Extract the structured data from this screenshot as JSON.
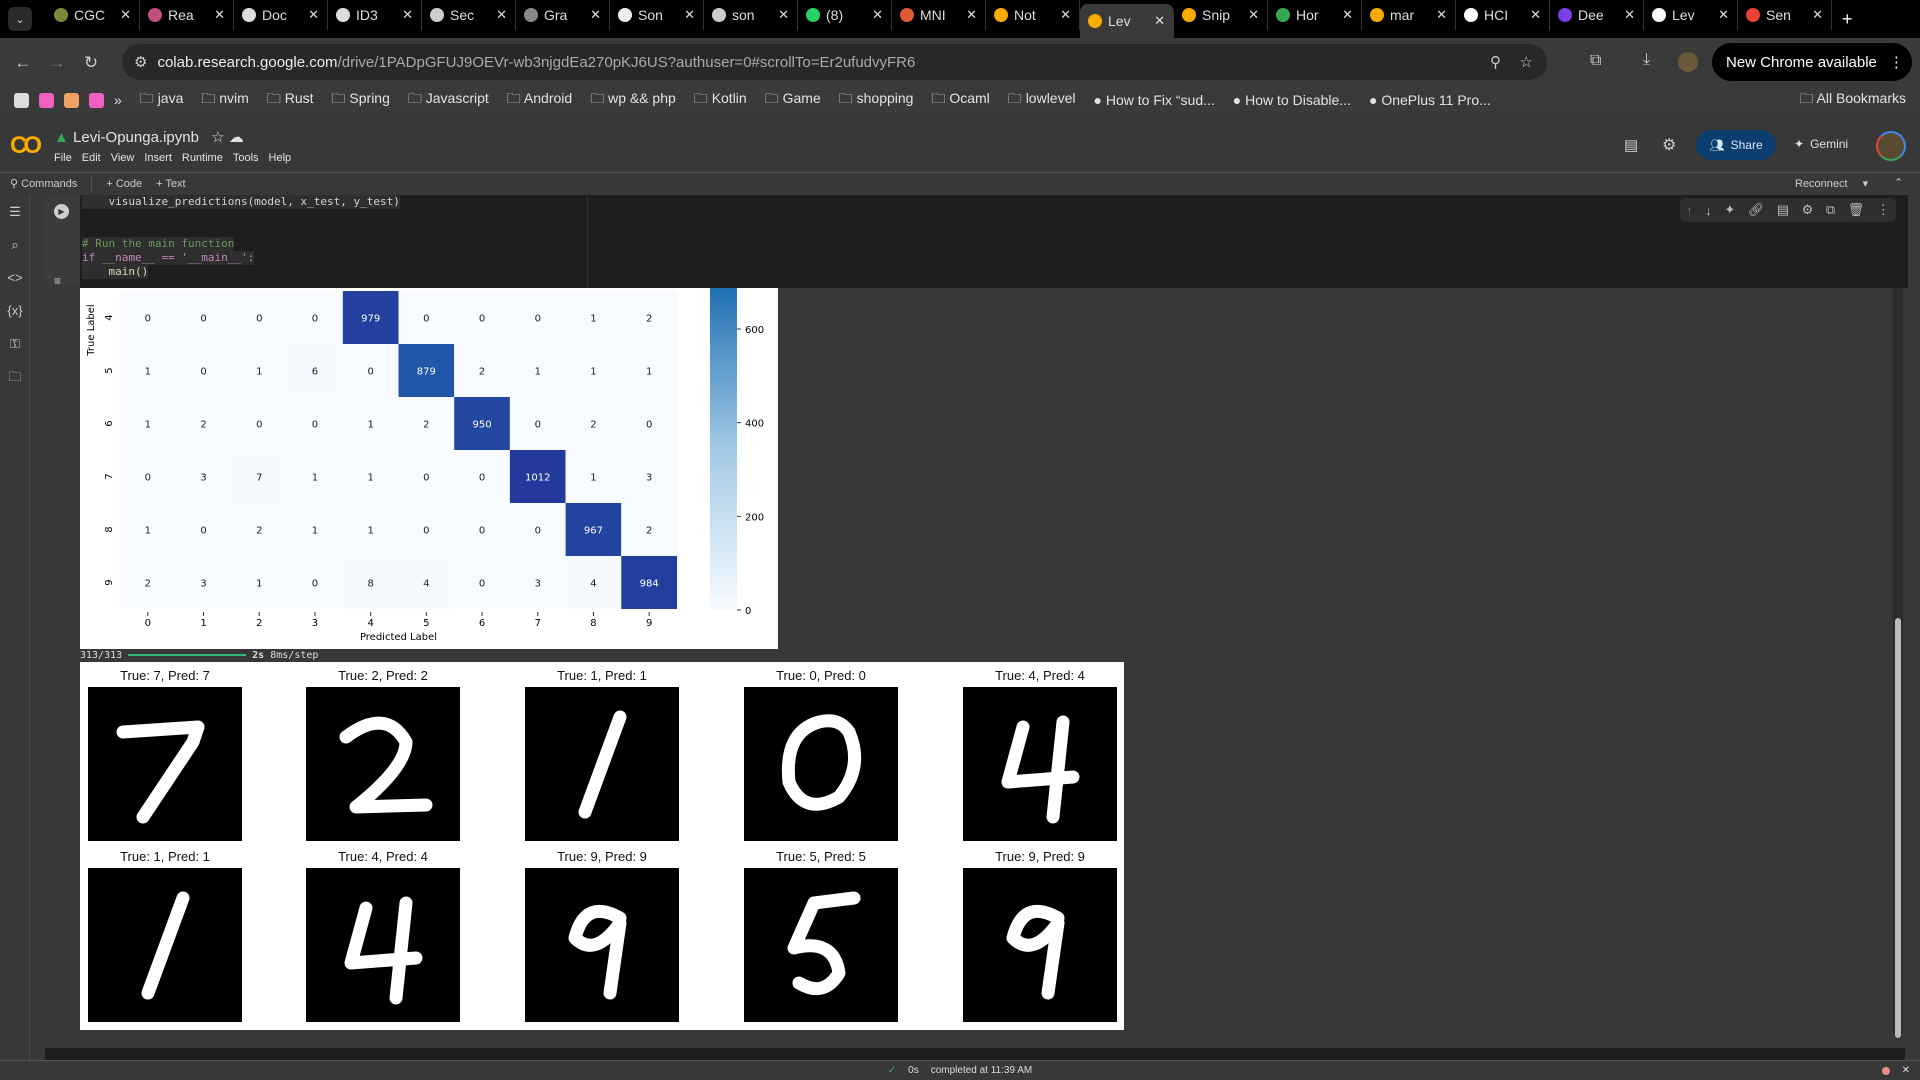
{
  "browser": {
    "tabs": [
      {
        "label": "CGC",
        "color": "#7a8a3a"
      },
      {
        "label": "Rea",
        "color": "#c05080"
      },
      {
        "label": "Doc",
        "color": "#ddd"
      },
      {
        "label": "ID3",
        "color": "#ddd"
      },
      {
        "label": "Sec",
        "color": "#ccc"
      },
      {
        "label": "Gra",
        "color": "#888"
      },
      {
        "label": "Son",
        "color": "#eee"
      },
      {
        "label": "son",
        "color": "#ccc"
      },
      {
        "label": "(8)",
        "color": "#25d366"
      },
      {
        "label": "MNI",
        "color": "#e05a3a"
      },
      {
        "label": "Not",
        "color": "#f9ab00"
      },
      {
        "label": "Lev",
        "color": "#f9ab00",
        "active": true
      },
      {
        "label": "Snip",
        "color": "#f9ab00"
      },
      {
        "label": "Hor",
        "color": "#34a853"
      },
      {
        "label": "mar",
        "color": "#f9ab00"
      },
      {
        "label": "HCI",
        "color": "#fff"
      },
      {
        "label": "Dee",
        "color": "#7b3fe4"
      },
      {
        "label": "Lev",
        "color": "#fff"
      },
      {
        "label": "Sen",
        "color": "#ea4335"
      }
    ],
    "url_host": "colab.research.google.com",
    "url_path": "/drive/1PADpGFUJ9OEVr-wb3njgdEa270pKJ6US?authuser=0#scrollTo=Er2ufudvyFR6",
    "new_chrome": "New Chrome available",
    "bookmark_colors": [
      "#ddd",
      "#f060c0",
      "#f0a060",
      "#f060c0"
    ],
    "bookmarks": [
      "java",
      "nvim",
      "Rust",
      "Spring",
      "Javascript",
      "Android",
      "wp && php",
      "Kotlin",
      "Game",
      "shopping",
      "Ocaml",
      "lowlevel",
      "How to Fix “sud...",
      "How to Disable...",
      "OnePlus 11 Pro..."
    ],
    "all_bookmarks": "All Bookmarks"
  },
  "colab": {
    "filename": "Levi-Opunga.ipynb",
    "menu": [
      "File",
      "Edit",
      "View",
      "Insert",
      "Runtime",
      "Tools",
      "Help"
    ],
    "toolbar": {
      "commands": "Commands",
      "code": "+ Code",
      "text": "+ Text",
      "reconnect": "Reconnect"
    },
    "share": "Share",
    "gemini": "Gemini",
    "code_lines": [
      "    visualize_predictions(model, x_test, y_test)",
      "",
      "",
      "# Run the main function",
      "if __name__ == '__main__':",
      "    main()"
    ],
    "progress": {
      "count": "313/313",
      "time": "2s",
      "rate": "8ms/step",
      "fraction": 1.0
    },
    "status": "completed at 11:39 AM",
    "status_time": "0s"
  },
  "chart_data": {
    "type": "heatmap",
    "xlabel": "Predicted Label",
    "ylabel": "True Label",
    "x_ticks": [
      "0",
      "1",
      "2",
      "3",
      "4",
      "5",
      "6",
      "7",
      "8",
      "9"
    ],
    "y_ticks": [
      "4",
      "5",
      "6",
      "7",
      "8",
      "9"
    ],
    "rows": [
      [
        0,
        0,
        0,
        0,
        979,
        0,
        0,
        0,
        1,
        2
      ],
      [
        1,
        0,
        1,
        6,
        0,
        879,
        2,
        1,
        1,
        1
      ],
      [
        1,
        2,
        0,
        0,
        1,
        2,
        950,
        0,
        2,
        0
      ],
      [
        0,
        3,
        7,
        1,
        1,
        0,
        0,
        1012,
        1,
        3
      ],
      [
        1,
        0,
        2,
        1,
        1,
        0,
        0,
        0,
        967,
        2
      ],
      [
        2,
        3,
        1,
        0,
        8,
        4,
        0,
        3,
        4,
        984
      ]
    ],
    "colorbar_ticks": [
      0,
      200,
      400,
      600
    ],
    "colormap": "Blues"
  },
  "predictions": [
    {
      "title": "True: 7, Pred: 7",
      "digit": "7"
    },
    {
      "title": "True: 2, Pred: 2",
      "digit": "2"
    },
    {
      "title": "True: 1, Pred: 1",
      "digit": "1"
    },
    {
      "title": "True: 0, Pred: 0",
      "digit": "0"
    },
    {
      "title": "True: 4, Pred: 4",
      "digit": "4"
    },
    {
      "title": "True: 1, Pred: 1",
      "digit": "1"
    },
    {
      "title": "True: 4, Pred: 4",
      "digit": "4"
    },
    {
      "title": "True: 9, Pred: 9",
      "digit": "9"
    },
    {
      "title": "True: 5, Pred: 5",
      "digit": "5"
    },
    {
      "title": "True: 9, Pred: 9",
      "digit": "9"
    }
  ]
}
